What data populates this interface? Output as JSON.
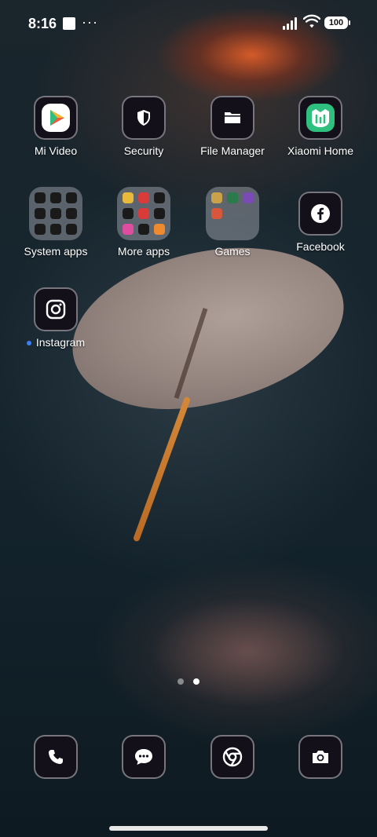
{
  "status_bar": {
    "time": "8:16",
    "more": "···",
    "battery": "100"
  },
  "home": {
    "row1": [
      {
        "label": "Mi Video",
        "icon": "mi-video-icon"
      },
      {
        "label": "Security",
        "icon": "shield-icon"
      },
      {
        "label": "File Manager",
        "icon": "folder-icon"
      },
      {
        "label": "Xiaomi Home",
        "icon": "xiaomi-home-icon"
      }
    ],
    "row2": [
      {
        "label": "System apps",
        "type": "folder"
      },
      {
        "label": "More apps",
        "type": "folder"
      },
      {
        "label": "Games",
        "type": "folder"
      },
      {
        "label": "Facebook",
        "icon": "facebook-icon"
      }
    ],
    "row3": [
      {
        "label": "Instagram",
        "icon": "instagram-icon",
        "new": true
      }
    ]
  },
  "page_indicator": {
    "pages": 2,
    "current": 2
  },
  "dock": [
    {
      "name": "phone",
      "icon": "phone-icon"
    },
    {
      "name": "messages",
      "icon": "message-icon"
    },
    {
      "name": "chrome",
      "icon": "chrome-icon"
    },
    {
      "name": "camera",
      "icon": "camera-icon"
    }
  ],
  "colors": {
    "accent_blue": "#3a7ff6",
    "mi_home_green": "#2fc07f"
  }
}
